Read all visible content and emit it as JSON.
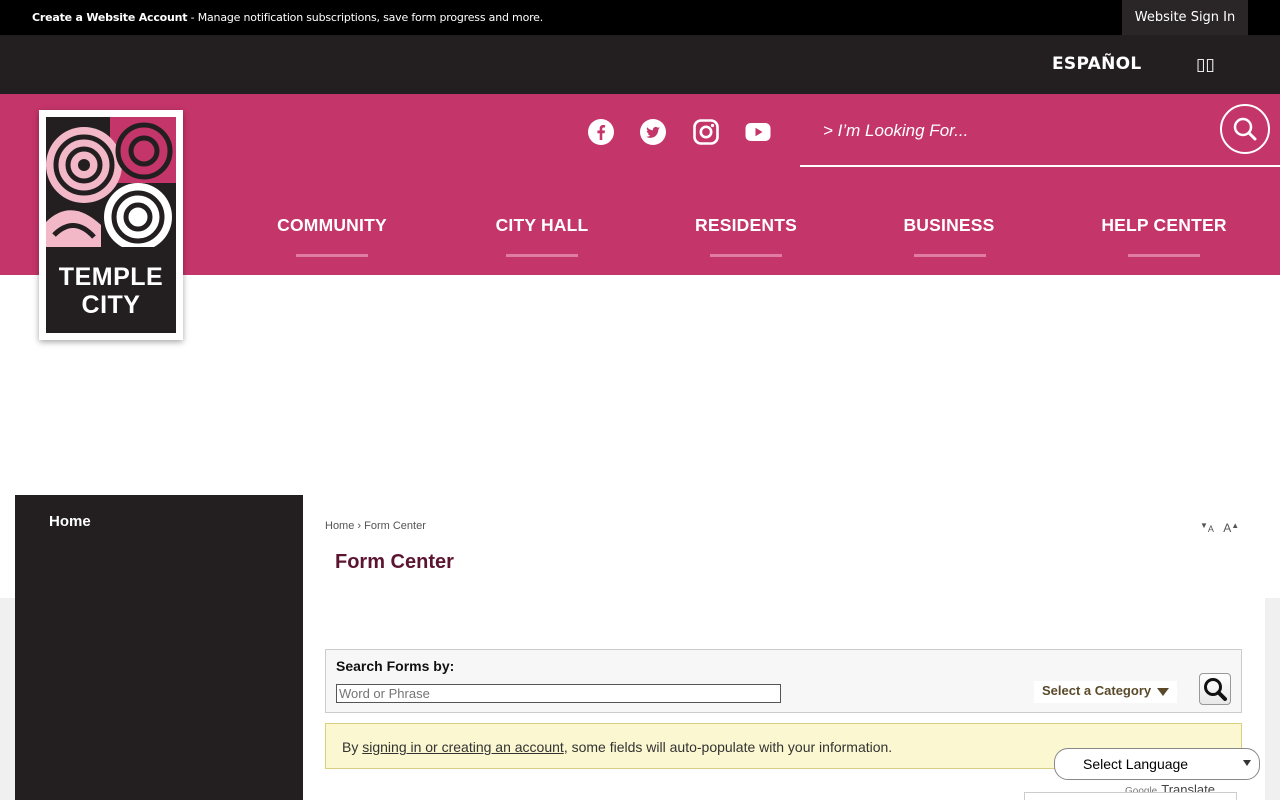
{
  "topbar": {
    "create_account": "Create a Website Account",
    "create_account_desc": " - Manage notification subscriptions, save form progress and more.",
    "sign_in": "Website Sign In"
  },
  "langbar": {
    "espanol": "ESPAÑOL",
    "chinese_glyph": "▯▯"
  },
  "header": {
    "search_placeholder": "> I’m Looking For...",
    "social": [
      "facebook-icon",
      "twitter-icon",
      "instagram-icon",
      "youtube-icon"
    ],
    "nav": [
      "COMMUNITY",
      "CITY HALL",
      "RESIDENTS",
      "BUSINESS",
      "HELP CENTER"
    ]
  },
  "logo": {
    "line1": "TEMPLE",
    "line2": "CITY"
  },
  "sidebar": {
    "home": "Home"
  },
  "breadcrumb": {
    "home": "Home",
    "sep": "›",
    "current": "Form Center"
  },
  "fontsize": {
    "decrease": "A",
    "increase": "A"
  },
  "page": {
    "title": "Form Center"
  },
  "search_forms": {
    "label": "Search Forms by:",
    "placeholder": "Word or Phrase",
    "category": "Select a Category"
  },
  "notice": {
    "prefix": "By ",
    "link": "signing in or creating an account",
    "suffix": ", some fields will auto-populate with your information."
  },
  "translate": {
    "select_label": "Select Language",
    "powered_brand": "Google",
    "powered_text": "Translate"
  },
  "colors": {
    "brand_pink": "#c4356a",
    "dark": "#231f20",
    "title": "#5c1530"
  }
}
